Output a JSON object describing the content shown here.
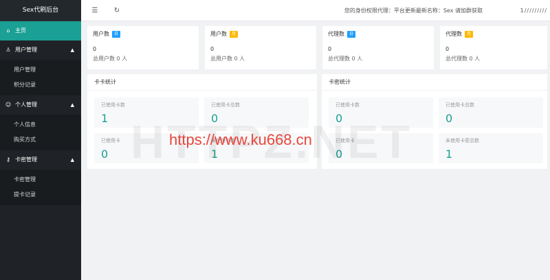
{
  "sidebar": {
    "brand": "Sex代刷后台",
    "home": {
      "icon": "home-icon",
      "label": "主页"
    },
    "groups": [
      {
        "icon": "user-icon",
        "label": "用户管理",
        "items": [
          "用户管理",
          "积分记录"
        ]
      },
      {
        "icon": "person-icon",
        "label": "个人管理",
        "items": [
          "个人信息",
          "购买方式"
        ]
      },
      {
        "icon": "key-icon",
        "label": "卡密管理",
        "items": [
          "卡密管理",
          "提卡记录"
        ]
      }
    ]
  },
  "topbar": {
    "menu_icon": "menu-fold-icon",
    "refresh_icon": "refresh-icon",
    "notice": "您的身份权限代理：平台更新最新名称：Sex 请加群获取",
    "right_text": "1/////////"
  },
  "stats": [
    {
      "title": "用户数",
      "badge": "日",
      "badge_color": "#1e9fff",
      "value": "0",
      "total": "总用户数 0 人"
    },
    {
      "title": "用户数",
      "badge": "月",
      "badge_color": "#ffb800",
      "value": "0",
      "total": "总用户数 0 人"
    },
    {
      "title": "代理数",
      "badge": "日",
      "badge_color": "#1e9fff",
      "value": "0",
      "total": "总代理数 0 人"
    },
    {
      "title": "代理数",
      "badge": "月",
      "badge_color": "#ffb800",
      "value": "0",
      "total": "总代理数 0 人"
    }
  ],
  "panels": [
    {
      "title": "卡卡统计",
      "metrics": [
        {
          "label": "已使用卡数",
          "value": "1"
        },
        {
          "label": "已使用卡总数",
          "value": "0"
        },
        {
          "label": "已使用卡",
          "value": "0"
        },
        {
          "label": "未使用卡数",
          "value": "1"
        }
      ]
    },
    {
      "title": "卡密统计",
      "metrics": [
        {
          "label": "已使用卡数",
          "value": "0"
        },
        {
          "label": "已使用卡总数",
          "value": "0"
        },
        {
          "label": "已使用卡",
          "value": "0"
        },
        {
          "label": "未使用卡密总数",
          "value": "1"
        }
      ]
    }
  ],
  "watermark": {
    "big": "HTTPZ.NET",
    "url": "https://www.ku668.cn"
  },
  "colors": {
    "accent": "#1aa094",
    "sidebar_bg": "#1f2327"
  }
}
